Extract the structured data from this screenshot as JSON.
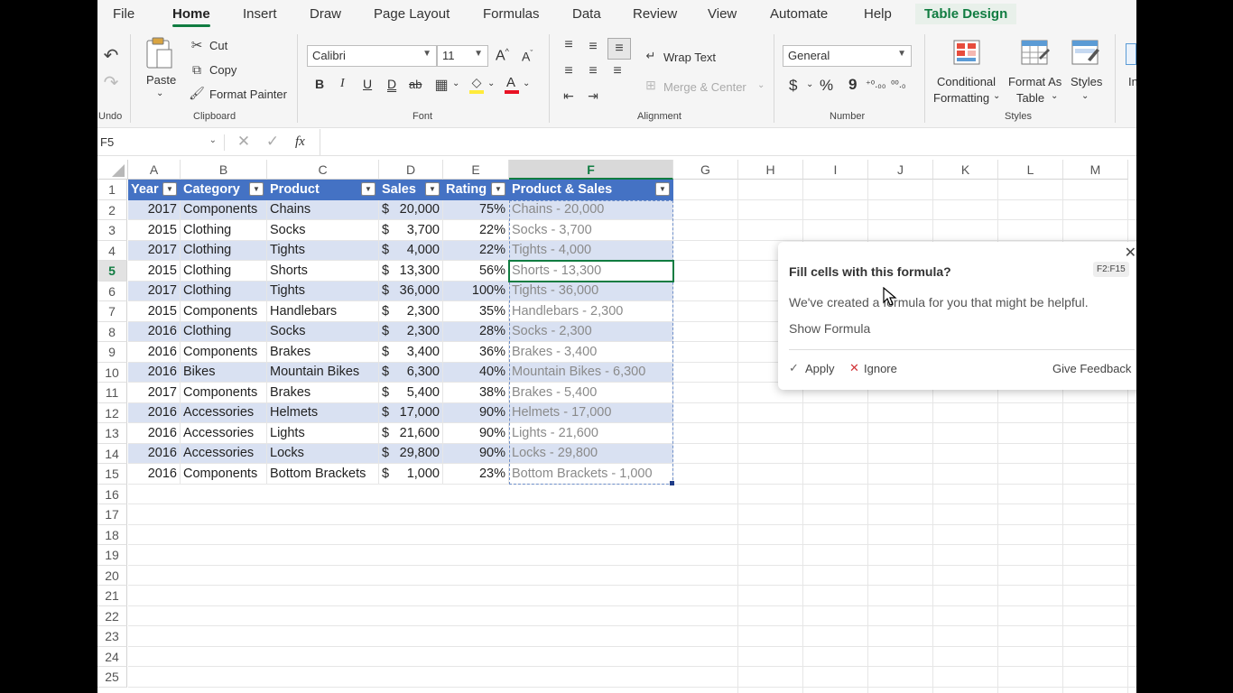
{
  "menu": {
    "tabs": [
      "File",
      "Home",
      "Insert",
      "Draw",
      "Page Layout",
      "Formulas",
      "Data",
      "Review",
      "View",
      "Automate",
      "Help",
      "Table Design"
    ],
    "active": "Home"
  },
  "ribbon": {
    "undo_label": "Undo",
    "clipboard": {
      "paste": "Paste",
      "cut": "Cut",
      "copy": "Copy",
      "format_painter": "Format Painter",
      "group": "Clipboard"
    },
    "font": {
      "name": "Calibri",
      "size": "11",
      "group": "Font",
      "bold": "B",
      "italic": "I",
      "underline": "U",
      "double_underline": "D",
      "strike": "ab"
    },
    "alignment": {
      "wrap_text": "Wrap Text",
      "merge_center": "Merge & Center",
      "group": "Alignment"
    },
    "number": {
      "format": "General",
      "currency": "$",
      "percent": "%",
      "comma": "9",
      "inc_decimal": "⁺⁰.₀₀",
      "dec_decimal": "⁰⁰.₀",
      "group": "Number"
    },
    "styles": {
      "conditional": "Conditional",
      "formatting": "Formatting",
      "format_as": "Format As",
      "table": "Table",
      "styles": "Styles",
      "group": "Styles"
    },
    "insert_partial": "In"
  },
  "formula_bar": {
    "name_box": "F5",
    "fx": "fx",
    "value": ""
  },
  "columns": [
    "A",
    "B",
    "C",
    "D",
    "E",
    "F",
    "G",
    "H",
    "I",
    "J",
    "K",
    "L",
    "M"
  ],
  "selected_column": "F",
  "selected_row": 5,
  "row_numbers": [
    "1",
    "2",
    "3",
    "4",
    "5",
    "6",
    "7",
    "8",
    "9",
    "10",
    "11",
    "12",
    "13",
    "14",
    "15",
    "16",
    "17",
    "18",
    "19",
    "20",
    "21",
    "22",
    "23",
    "24",
    "25"
  ],
  "table": {
    "headers": [
      "Year",
      "Category",
      "Product",
      "Sales",
      "Rating",
      "Product & Sales"
    ],
    "rows": [
      [
        "2017",
        "Components",
        "Chains",
        "$ 20,000",
        "75%",
        "Chains - 20,000"
      ],
      [
        "2015",
        "Clothing",
        "Socks",
        "$   3,700",
        "22%",
        "Socks - 3,700"
      ],
      [
        "2017",
        "Clothing",
        "Tights",
        "$   4,000",
        "22%",
        "Tights - 4,000"
      ],
      [
        "2015",
        "Clothing",
        "Shorts",
        "$ 13,300",
        "56%",
        "Shorts - 13,300"
      ],
      [
        "2017",
        "Clothing",
        "Tights",
        "$ 36,000",
        "100%",
        "Tights - 36,000"
      ],
      [
        "2015",
        "Components",
        "Handlebars",
        "$   2,300",
        "35%",
        "Handlebars - 2,300"
      ],
      [
        "2016",
        "Clothing",
        "Socks",
        "$   2,300",
        "28%",
        "Socks - 2,300"
      ],
      [
        "2016",
        "Components",
        "Brakes",
        "$   3,400",
        "36%",
        "Brakes - 3,400"
      ],
      [
        "2016",
        "Bikes",
        "Mountain Bikes",
        "$   6,300",
        "40%",
        "Mountain Bikes - 6,300"
      ],
      [
        "2017",
        "Components",
        "Brakes",
        "$   5,400",
        "38%",
        "Brakes - 5,400"
      ],
      [
        "2016",
        "Accessories",
        "Helmets",
        "$ 17,000",
        "90%",
        "Helmets - 17,000"
      ],
      [
        "2016",
        "Accessories",
        "Lights",
        "$ 21,600",
        "90%",
        "Lights - 21,600"
      ],
      [
        "2016",
        "Accessories",
        "Locks",
        "$ 29,800",
        "90%",
        "Locks - 29,800"
      ],
      [
        "2016",
        "Components",
        "Bottom Brackets",
        "$   1,000",
        "23%",
        "Bottom Brackets - 1,000"
      ]
    ]
  },
  "popup": {
    "title": "Fill cells with this formula?",
    "range_badge": "F2:F15",
    "body": "We've created a formula for you that might be helpful.",
    "show_formula": "Show Formula",
    "apply": "Apply",
    "ignore": "Ignore",
    "feedback": "Give Feedback"
  },
  "colors": {
    "accent": "#107c41",
    "table_header": "#4472c4",
    "table_band": "#d9e1f2"
  }
}
